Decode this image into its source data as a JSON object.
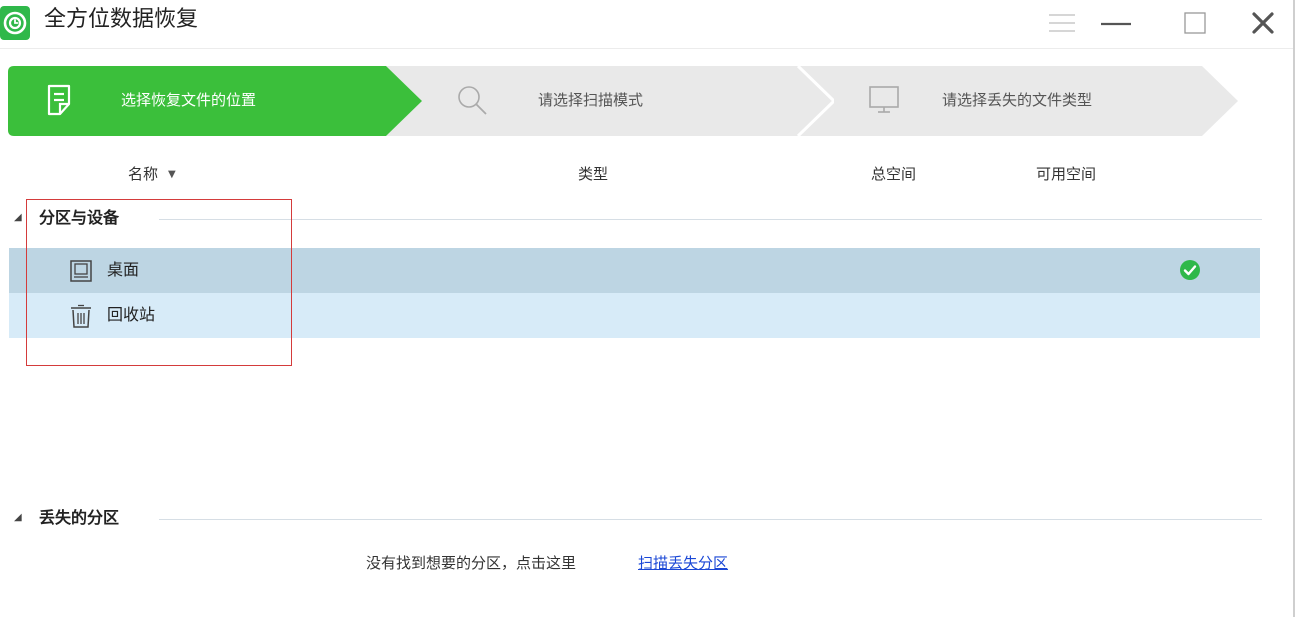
{
  "window": {
    "title": "全方位数据恢复"
  },
  "steps": [
    {
      "label": "选择恢复文件的位置",
      "icon": "document-edit-icon",
      "active": true
    },
    {
      "label": "请选择扫描模式",
      "icon": "search-icon",
      "active": false
    },
    {
      "label": "请选择丢失的文件类型",
      "icon": "monitor-icon",
      "active": false
    }
  ],
  "table": {
    "columns": {
      "name": "名称",
      "type": "类型",
      "total": "总空间",
      "free": "可用空间"
    }
  },
  "groups": {
    "devices": {
      "title": "分区与设备",
      "items": [
        {
          "label": "桌面",
          "icon": "desktop-icon",
          "checked": true
        },
        {
          "label": "回收站",
          "icon": "recycle-bin-icon",
          "checked": false
        }
      ]
    },
    "lost": {
      "title": "丢失的分区",
      "hint": "没有找到想要的分区，点击这里",
      "link": "扫描丢失分区"
    }
  },
  "colors": {
    "accent": "#3bbf3b",
    "step_inactive": "#e9e9e9",
    "row_selected": "#bdd5e3",
    "row_hover": "#d7ebf8",
    "link": "#1a47d6",
    "highlight_box": "#d43b3b"
  }
}
